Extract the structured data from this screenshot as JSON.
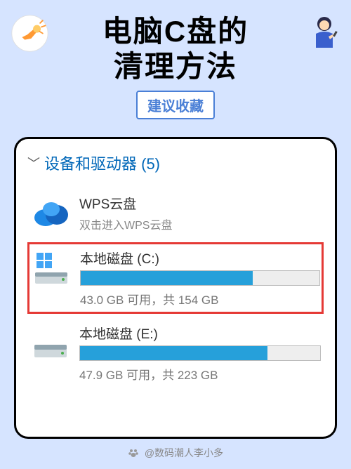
{
  "header": {
    "title_line1": "电脑C盘的",
    "title_line2": "清理方法",
    "subtitle": "建议收藏"
  },
  "section": {
    "label": "设备和驱动器 (5)"
  },
  "drives": [
    {
      "name": "WPS云盘",
      "subtitle": "双击进入WPS云盘",
      "type": "cloud"
    },
    {
      "name": "本地磁盘 (C:)",
      "stats": "43.0 GB 可用，共 154 GB",
      "used_percent": 72,
      "type": "local",
      "highlighted": true
    },
    {
      "name": "本地磁盘 (E:)",
      "stats": "47.9 GB 可用，共 223 GB",
      "used_percent": 78,
      "type": "local",
      "highlighted": false
    }
  ],
  "watermark": "@数码潮人李小多"
}
